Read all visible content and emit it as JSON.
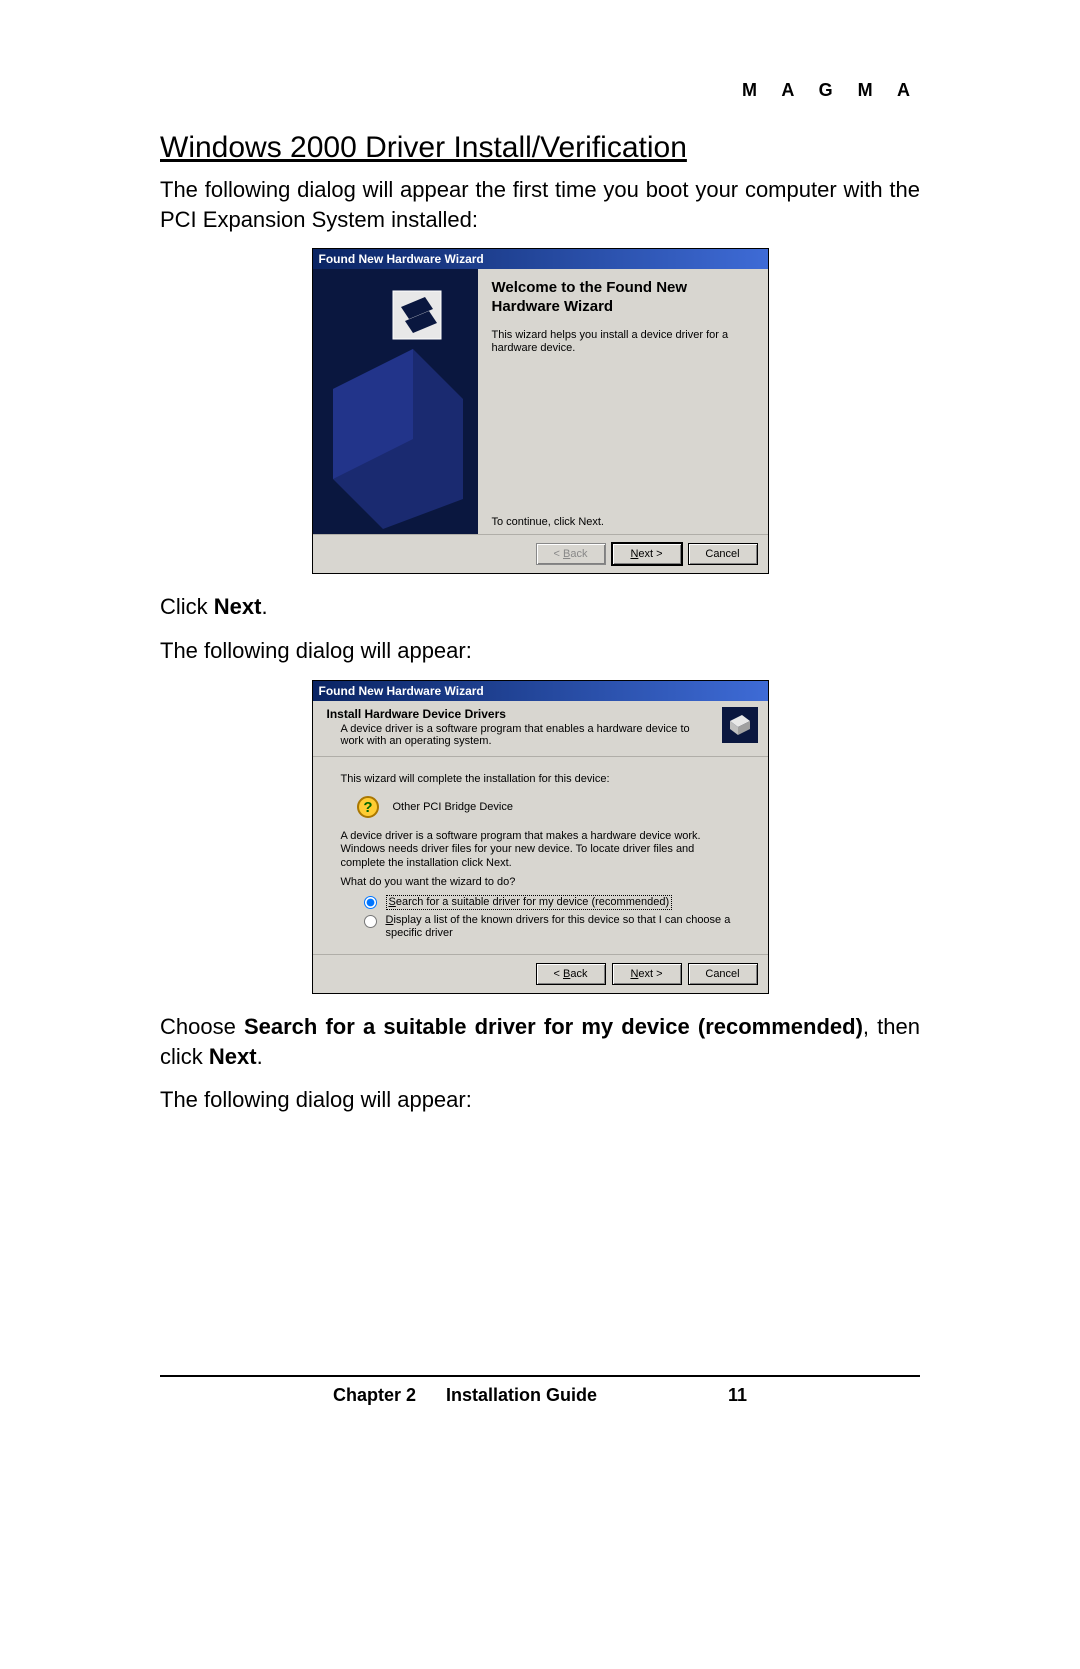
{
  "brand": "M A G M A",
  "section_title": "Windows 2000 Driver Install/Verification",
  "intro": "The following dialog will appear the first time you boot your computer with the PCI Expansion System installed:",
  "click_next_pre": "Click ",
  "click_next_bold": "Next",
  "click_next_post": ".",
  "following2": "The following dialog will appear:",
  "choose_pre": "Choose ",
  "choose_bold": "Search for a suitable driver for my device (recommended)",
  "choose_mid": ", then click ",
  "choose_bold2": "Next",
  "choose_post": ".",
  "following3": "The following dialog will appear:",
  "dlg1": {
    "title": "Found New Hardware Wizard",
    "heading": "Welcome to the Found New Hardware Wizard",
    "desc": "This wizard helps you install a device driver for a hardware device.",
    "continue": "To continue, click Next.",
    "back": "< Back",
    "next": "Next >",
    "cancel": "Cancel"
  },
  "dlg2": {
    "title": "Found New Hardware Wizard",
    "head_title": "Install Hardware Device Drivers",
    "head_sub": "A device driver is a software program that enables a hardware device to work with an operating system.",
    "line1": "This wizard will complete the installation for this device:",
    "device": "Other PCI Bridge Device",
    "line2": "A device driver is a software program that makes a hardware device work. Windows needs driver files for your new device. To locate driver files and complete the installation click Next.",
    "line3": "What do you want the wizard to do?",
    "opt1": "Search for a suitable driver for my device (recommended)",
    "opt2": "Display a list of the known drivers for this device so that I can choose a specific driver",
    "back": "< Back",
    "next": "Next >",
    "cancel": "Cancel"
  },
  "footer": {
    "chapter": "Chapter 2",
    "guide": "Installation Guide",
    "page": "11"
  }
}
